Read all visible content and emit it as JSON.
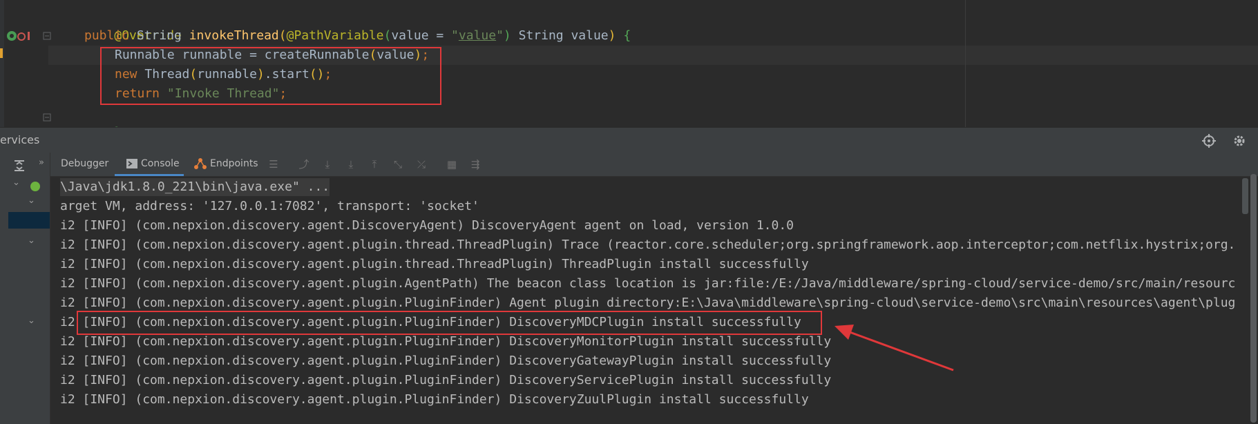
{
  "editor": {
    "lines": {
      "override": "@Override",
      "sig_public": "public ",
      "sig_string": "String ",
      "sig_method": "invokeThread",
      "sig_open": "(",
      "sig_ann": "@PathVariable",
      "sig_open2": "(",
      "sig_value_eq": "value = ",
      "sig_q1": "\"",
      "sig_link": "value",
      "sig_q2": "\"",
      "sig_close2": ")",
      "sig_rest": " String value",
      "sig_close": ")",
      "sig_brace": " {",
      "l1_a": "Runnable runnable = createRunnable",
      "l1_p1": "(",
      "l1_b": "value",
      "l1_p2": ")",
      "l1_c": ";",
      "l2_new": "new ",
      "l2_a": "Thread",
      "l2_p1": "(",
      "l2_b": "runnable",
      "l2_p2": ")",
      "l2_c": ".start",
      "l2_p3": "()",
      "l2_d": ";",
      "l3_ret": "return ",
      "l3_str": "\"Invoke Thread\"",
      "l3_d": ";",
      "close_brace": "}"
    }
  },
  "services": {
    "title": "ervices"
  },
  "toolbar": {
    "tabs": {
      "debugger": "Debugger",
      "console": "Console",
      "endpoints": "Endpoints"
    }
  },
  "console": {
    "lines": [
      "\\Java\\jdk1.8.0_221\\bin\\java.exe\" ...",
      "arget VM, address: '127.0.0.1:7082', transport: 'socket'",
      "i2 [INFO] (com.nepxion.discovery.agent.DiscoveryAgent) DiscoveryAgent agent on load, version 1.0.0",
      "i2 [INFO] (com.nepxion.discovery.agent.plugin.thread.ThreadPlugin) Trace (reactor.core.scheduler;org.springframework.aop.interceptor;com.netflix.hystrix;org.",
      "i2 [INFO] (com.nepxion.discovery.agent.plugin.thread.ThreadPlugin) ThreadPlugin install successfully",
      "i2 [INFO] (com.nepxion.discovery.agent.plugin.AgentPath) The beacon class location is jar:file:/E:/Java/middleware/spring-cloud/service-demo/src/main/resourc",
      "i2 [INFO] (com.nepxion.discovery.agent.plugin.PluginFinder) Agent plugin directory:E:\\Java\\middleware\\spring-cloud\\service-demo\\src\\main\\resources\\agent\\plug",
      "i2 [INFO] (com.nepxion.discovery.agent.plugin.PluginFinder) DiscoveryMDCPlugin install successfully",
      "i2 [INFO] (com.nepxion.discovery.agent.plugin.PluginFinder) DiscoveryMonitorPlugin install successfully",
      "i2 [INFO] (com.nepxion.discovery.agent.plugin.PluginFinder) DiscoveryGatewayPlugin install successfully",
      "i2 [INFO] (com.nepxion.discovery.agent.plugin.PluginFinder) DiscoveryServicePlugin install successfully",
      "i2 [INFO] (com.nepxion.discovery.agent.plugin.PluginFinder) DiscoveryZuulPlugin install successfully"
    ]
  },
  "icons": {
    "target": "crosshair-icon",
    "settings": "gear-icon",
    "console_tab": "console-icon",
    "endpoints_tab": "endpoints-icon"
  },
  "colors": {
    "annotation_box": "#e0383a",
    "console_tab_underline": "#4a88c7"
  }
}
